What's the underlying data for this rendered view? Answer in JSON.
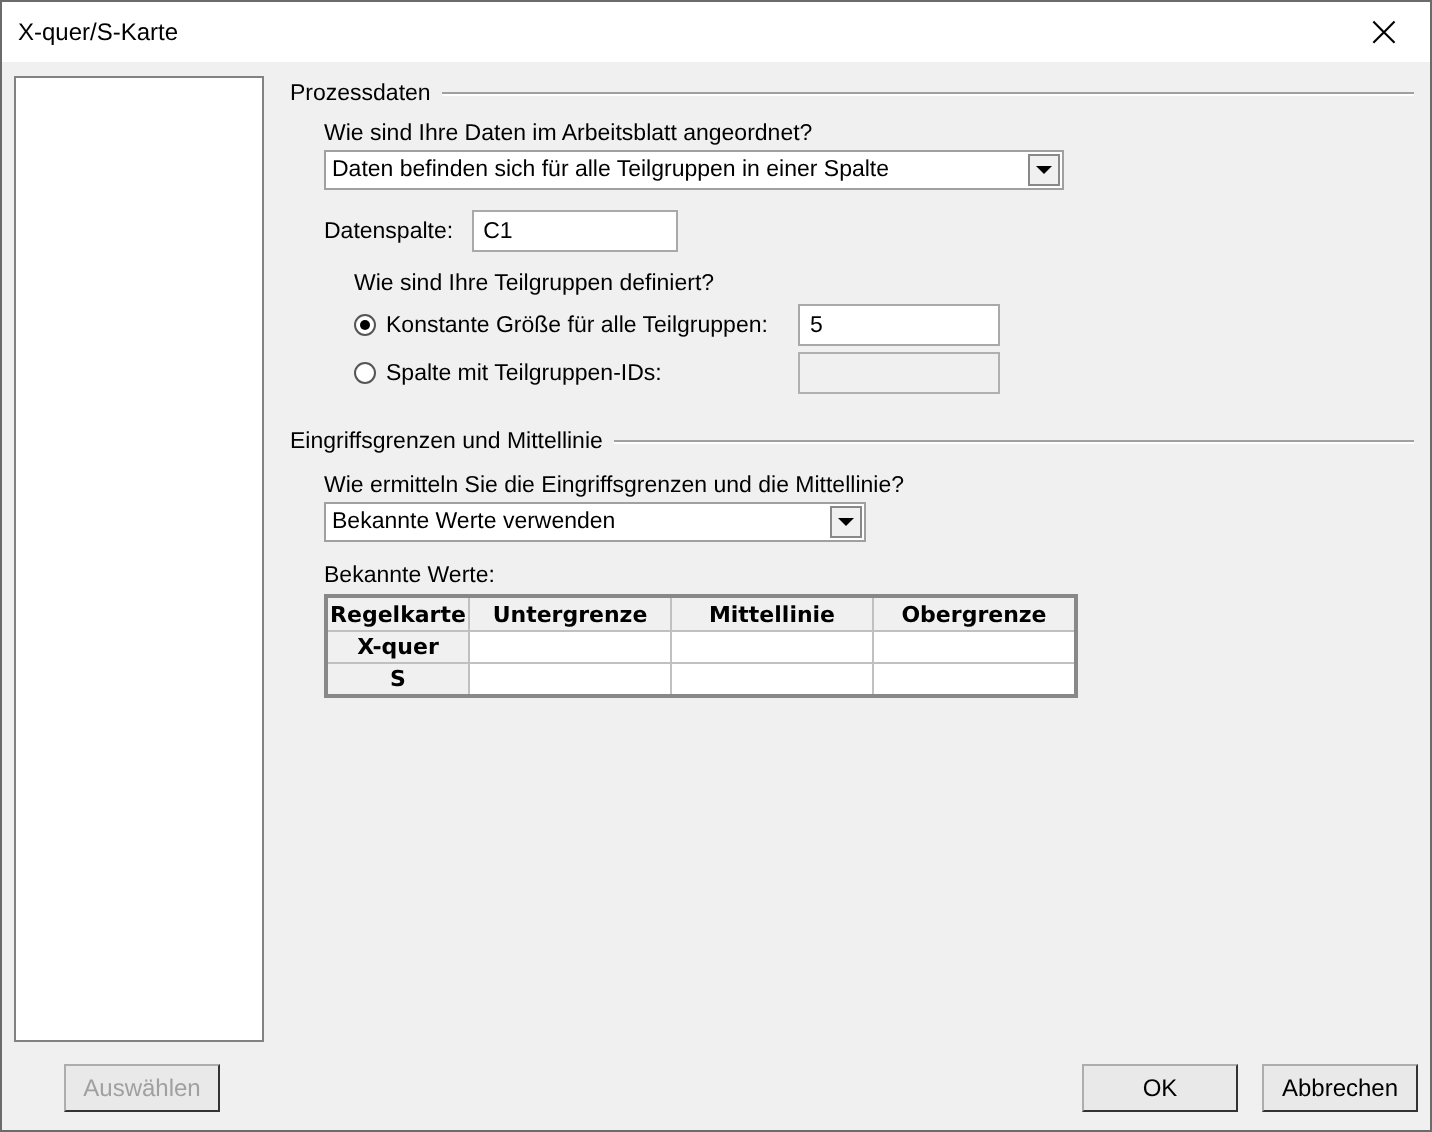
{
  "window": {
    "title": "X-quer/S-Karte",
    "close": "×"
  },
  "process_data": {
    "heading": "Prozessdaten",
    "arrangement_question": "Wie sind Ihre Daten im Arbeitsblatt angeordnet?",
    "arrangement_value": "Daten befinden sich für alle Teilgruppen in einer Spalte",
    "data_column_label": "Datenspalte:",
    "data_column_value": "C1",
    "subgroup_question": "Wie sind Ihre Teilgruppen definiert?",
    "subgroup_options": [
      {
        "label": "Konstante Größe für alle Teilgruppen:",
        "selected": true,
        "value": "5",
        "disabled": false
      },
      {
        "label": "Spalte mit Teilgruppen-IDs:",
        "selected": false,
        "disabled": true
      }
    ]
  },
  "limits": {
    "heading": "Eingriffsgrenzen und Mittellinie",
    "method_question": "Wie ermitteln Sie die Eingriffsgrenzen und die Mittellinie?",
    "method_value": "Bekannte Werte verwenden",
    "known_values_label": "Bekannte Werte:",
    "table": {
      "columns": [
        "Regelkarte",
        "Untergrenze",
        "Mittellinie",
        "Obergrenze"
      ],
      "rows": [
        {
          "chart": "X-quer"
        },
        {
          "chart": "S"
        }
      ]
    }
  },
  "buttons": [
    {
      "label": "Auswählen",
      "disabled": true
    },
    {
      "label": "OK",
      "disabled": false
    },
    {
      "label": "Abbrechen",
      "disabled": false
    }
  ]
}
